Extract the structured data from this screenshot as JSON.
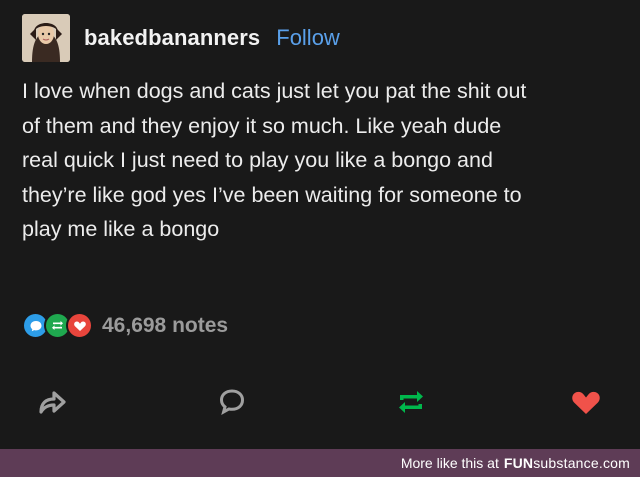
{
  "post": {
    "username": "bakedbananners",
    "follow_label": "Follow",
    "body_lines": [
      "I love when dogs and cats just let you pat the shit out",
      "of them and they enjoy it so much. Like yeah dude",
      "real quick I just need to play you like a bongo and",
      "they’re like god yes I’ve been waiting for someone to",
      "play me like a bongo"
    ],
    "notes": {
      "count_label": "46,698 notes",
      "icons": [
        "reply-icon",
        "reblog-icon",
        "like-icon"
      ],
      "colors": {
        "reply": "#2d9de8",
        "reblog": "#1fa84f",
        "like": "#e8453c"
      }
    },
    "actions": [
      "share-icon",
      "comment-icon",
      "reblog-icon",
      "like-icon"
    ],
    "action_colors": {
      "share": "#9a9a9a",
      "comment": "#9a9a9a",
      "reblog": "#00b84c",
      "like": "#f0524a"
    },
    "follow_color": "#5aa0ea"
  },
  "footer": {
    "text": "More like this at",
    "brand_bold": "FUN",
    "brand_light": "substance",
    "brand_suffix": ".com",
    "background": "#5e3c56"
  }
}
